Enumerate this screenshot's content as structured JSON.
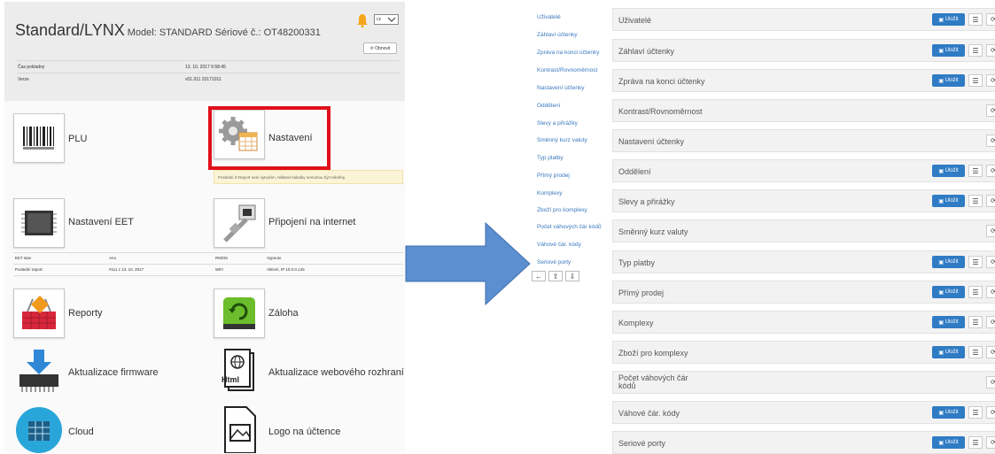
{
  "device": {
    "title": "Standard/LYNX",
    "subtitle": "Model: STANDARD Sériové č.: OT48200331",
    "lang_value": "cz",
    "refresh_label": "⟳ Obnovit",
    "info": [
      {
        "label": "Čas pokladny",
        "value": "13. 10. 2017 6:58:45"
      },
      {
        "label": "Verze",
        "value": "v01.011 20171011"
      }
    ]
  },
  "tiles": {
    "plu": "PLU",
    "settings": "Nastavení",
    "settings_notice": "Poslední Z-Report není vytvořen. Některé tabulky nemohou být měněny.",
    "eet": "Nastavení EET",
    "internet": "Připojení na internet",
    "eet_info": [
      {
        "label": "EET stav",
        "value": "Ano"
      },
      {
        "label": "Poslední report:",
        "value": "#111 z 13. 10. 2017"
      }
    ],
    "net_info": [
      {
        "label": "RNDIS",
        "value": "Vypnuto"
      },
      {
        "label": "WiFi",
        "value": "Aktivní, IP 10.0.0.125"
      }
    ],
    "reports": "Reporty",
    "backup": "Záloha",
    "firmware": "Aktualizace firmware",
    "web": "Aktualizace webového rozhraní",
    "cloud": "Cloud",
    "logo": "Logo na účtence",
    "html_badge": "Html"
  },
  "nav": [
    "Uživatelé",
    "Záhlaví účtenky",
    "Zpráva na konci účtenky",
    "Kontrast/Rovnoměrnost",
    "Nastavení účtenky",
    "Oddělení",
    "Slevy a přirážky",
    "Směnný kurz valuty",
    "Typ platby",
    "Přímý prodej",
    "Komplexy",
    "Zboží pro komplexy",
    "Počet váhových čár kódů",
    "Váhové čár. kódy",
    "Seriové porty"
  ],
  "rows": [
    {
      "label": "Uživatelé"
    },
    {
      "label": "Záhlaví účtenky"
    },
    {
      "label": "Zpráva na konci účtenky"
    },
    {
      "label": "Kontrast/Rovnoměrnost"
    },
    {
      "label": "Nastavení účtenky"
    },
    {
      "label": "Oddělení"
    },
    {
      "label": "Slevy a přirážky"
    },
    {
      "label": "Směnný kurz valuty"
    },
    {
      "label": "Typ platby"
    },
    {
      "label": "Přímý prodej"
    },
    {
      "label": "Komplexy"
    },
    {
      "label": "Zboží pro komplexy"
    },
    {
      "label": "Počet váhových čár kódů",
      "label_line1": "Počet váhových čár",
      "label_line2": "kódů"
    },
    {
      "label": "Váhové čár. kódy"
    },
    {
      "label": "Seriové porty"
    }
  ],
  "save_label": "Uložit",
  "colors": {
    "accent": "#2f7bc4",
    "highlight": "#e0101a",
    "arrow": "#5b8fd0",
    "link": "#3a7abf"
  }
}
